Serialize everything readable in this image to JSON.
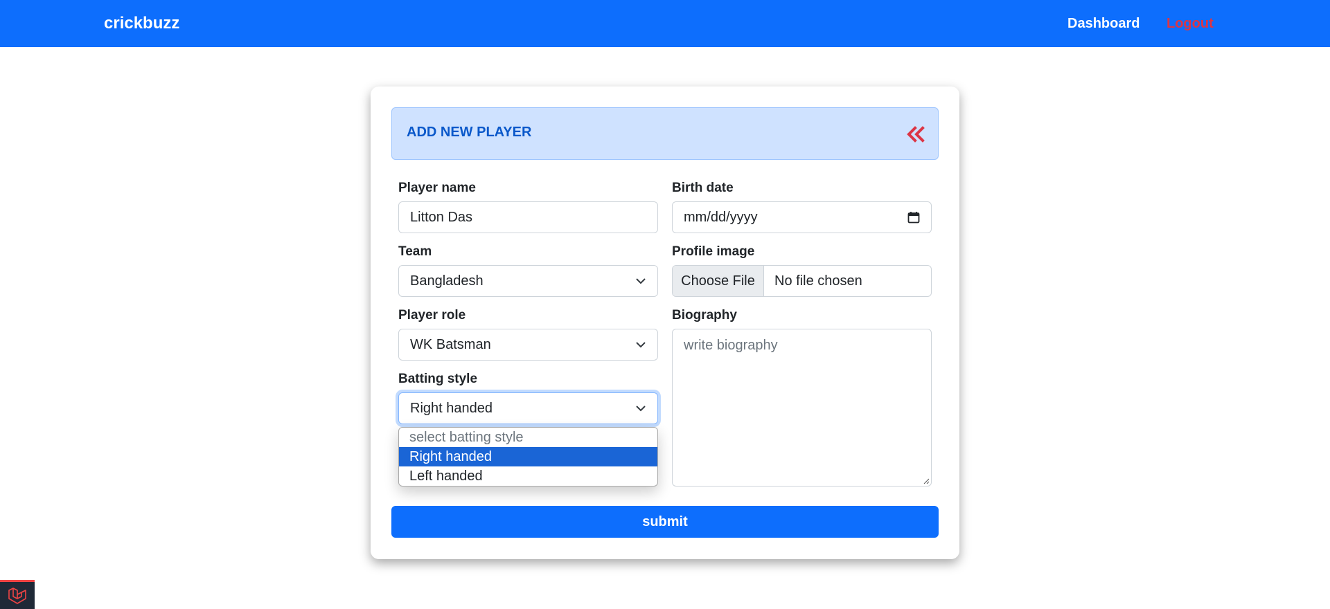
{
  "navbar": {
    "brand": "crickbuzz",
    "dashboard_label": "Dashboard",
    "logout_label": "Logout",
    "color": "#0d6efd"
  },
  "form": {
    "title": "ADD NEW PLAYER",
    "back_icon": "double-chevron-left-icon",
    "player_name": {
      "label": "Player name",
      "value": "Litton Das"
    },
    "birth_date": {
      "label": "Birth date",
      "placeholder": "mm/dd/yyyy"
    },
    "team": {
      "label": "Team",
      "value": "Bangladesh"
    },
    "profile_image": {
      "label": "Profile image",
      "button": "Choose File",
      "status": "No file chosen"
    },
    "player_role": {
      "label": "Player role",
      "value": "WK Batsman"
    },
    "biography": {
      "label": "Biography",
      "placeholder": "write biography"
    },
    "batting_style": {
      "label": "Batting style",
      "value": "Right handed",
      "options": [
        "select batting style",
        "Right handed",
        "Left handed"
      ],
      "selected_index": 1
    },
    "submit_label": "submit"
  }
}
